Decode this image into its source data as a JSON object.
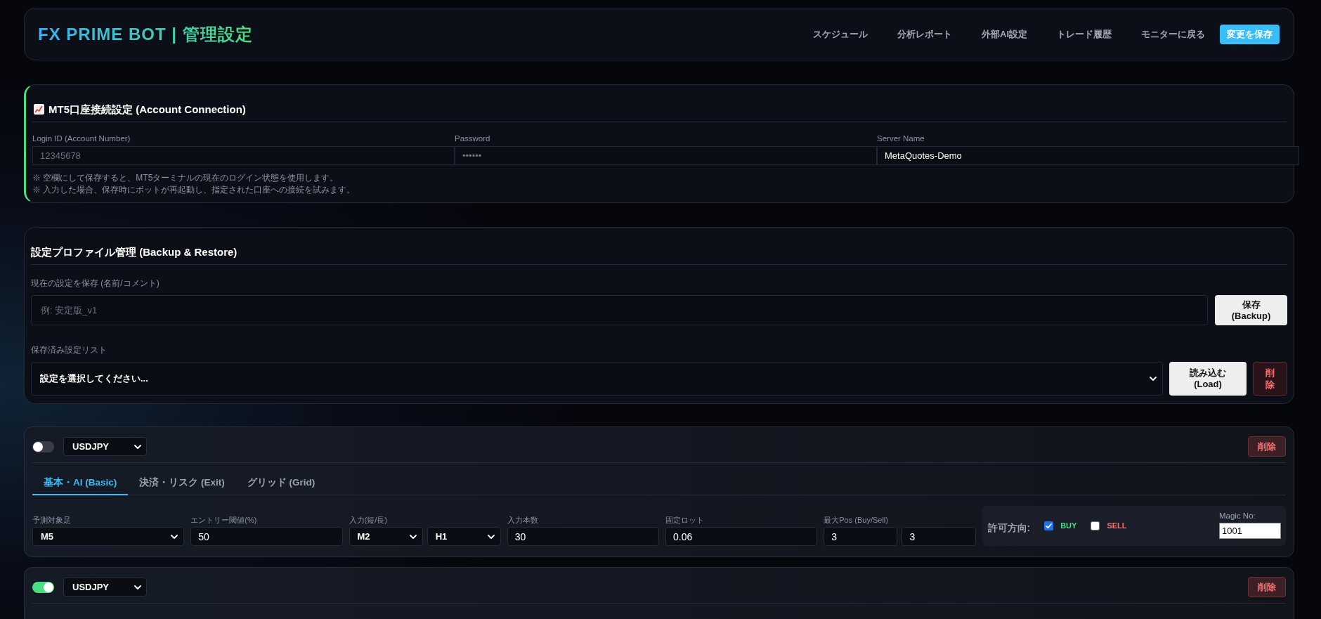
{
  "header": {
    "title": "FX PRIME BOT | 管理設定",
    "nav": [
      {
        "label": "スケジュール"
      },
      {
        "label": "分析レポート"
      },
      {
        "label": "外部AI設定"
      },
      {
        "label": "トレード履歴"
      },
      {
        "label": "モニターに戻る"
      }
    ],
    "save_button": "変更を保存"
  },
  "account": {
    "title": "MT5口座接続設定 (Account Connection)",
    "fields": [
      {
        "label": "Login ID (Account Number)",
        "placeholder": "12345678"
      },
      {
        "label": "Password",
        "placeholder": "••••••"
      },
      {
        "label": "Server Name",
        "value": "MetaQuotes-Demo"
      }
    ],
    "notes": [
      "※ 空欄にして保存すると、MT5ターミナルの現在のログイン状態を使用します。",
      "※ 入力した場合、保存時にボットが再起動し、指定された口座への接続を試みます。"
    ]
  },
  "backup": {
    "title": "設定プロファイル管理 (Backup & Restore)",
    "save_label": "現在の設定を保存 (名前/コメント)",
    "name_field": {
      "placeholder": "例: 安定版_v1"
    },
    "save_button": "保存 (Backup)",
    "list_label": "保存済み設定リスト",
    "profile_select": "設定を選択してください...",
    "load_button": "読み込む (Load)",
    "delete_button": "削除"
  },
  "pairs": [
    {
      "enabled": false,
      "symbol": "USDJPY",
      "delete_button": "削除",
      "tabs": [
        {
          "label": "基本・AI (Basic)",
          "selected": true
        },
        {
          "label": "決済・リスク (Exit)",
          "selected": false
        },
        {
          "label": "グリッド (Grid)",
          "selected": false
        }
      ],
      "fields": [
        {
          "label": "予測対象足",
          "kind": "select",
          "values": [
            "M5"
          ]
        },
        {
          "label": "エントリー閾値(%)",
          "kind": "input",
          "values": [
            "50"
          ]
        },
        {
          "label": "入力(短/長)",
          "kind": "select",
          "values": [
            "M2",
            "H1"
          ]
        },
        {
          "label": "入力本数",
          "kind": "input",
          "values": [
            "30"
          ]
        },
        {
          "label": "固定ロット",
          "kind": "input",
          "values": [
            "0.06"
          ]
        },
        {
          "label": "最大Pos (Buy/Sell)",
          "kind": "input",
          "values": [
            "3",
            "3"
          ]
        }
      ],
      "permit": {
        "label": "許可方向:",
        "options": [
          {
            "label": "BUY",
            "checked": true,
            "color": "#4ade80"
          },
          {
            "label": "SELL",
            "checked": false,
            "color": "#f87171"
          }
        ],
        "magic_label": "Magic No:",
        "magic_value": "1001"
      }
    },
    {
      "enabled": true,
      "symbol": "USDJPY",
      "delete_button": "削除"
    }
  ]
}
